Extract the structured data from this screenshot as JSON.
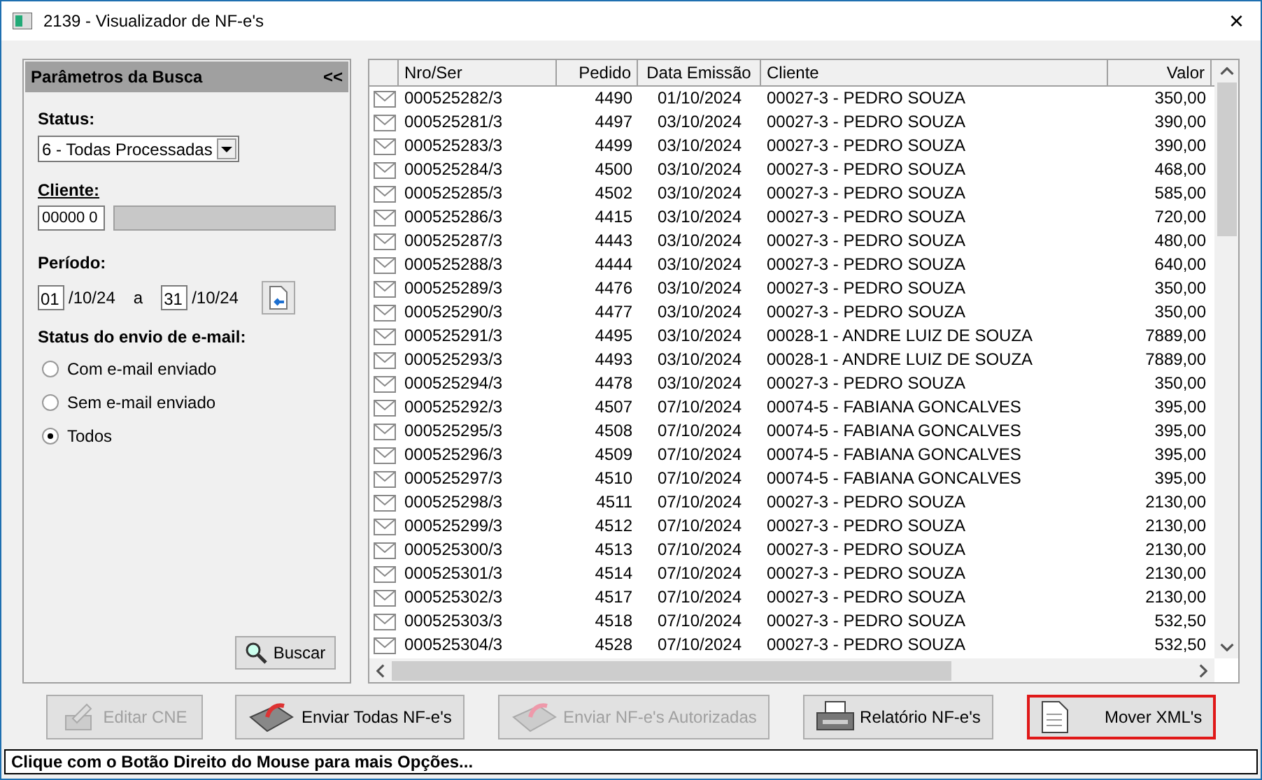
{
  "window": {
    "title": "2139 - Visualizador de NF-e's",
    "close": "×"
  },
  "search_panel": {
    "title": "Parâmetros da Busca",
    "collapse": "<<",
    "status_label": "Status:",
    "status_value": "6 - Todas Processadas",
    "client_label": "Cliente:",
    "client_code": "00000 0",
    "period_label": "Período:",
    "from_day": "01",
    "from_rest": "/10/24",
    "separator": "a",
    "to_day": "31",
    "to_rest": "/10/24",
    "email_label": "Status do envio de e-mail:",
    "email_options": [
      {
        "label": "Com e-mail enviado",
        "selected": false
      },
      {
        "label": "Sem e-mail enviado",
        "selected": false
      },
      {
        "label": "Todos",
        "selected": true
      }
    ],
    "search_button": "Buscar"
  },
  "table": {
    "columns": [
      "Nro/Ser",
      "Pedido",
      "Data Emissão",
      "Cliente",
      "Valor"
    ],
    "rows": [
      [
        "000525282/3",
        "4490",
        "01/10/2024",
        "00027-3 - PEDRO SOUZA",
        "350,00"
      ],
      [
        "000525281/3",
        "4497",
        "03/10/2024",
        "00027-3 - PEDRO SOUZA",
        "390,00"
      ],
      [
        "000525283/3",
        "4499",
        "03/10/2024",
        "00027-3 - PEDRO SOUZA",
        "390,00"
      ],
      [
        "000525284/3",
        "4500",
        "03/10/2024",
        "00027-3 - PEDRO SOUZA",
        "468,00"
      ],
      [
        "000525285/3",
        "4502",
        "03/10/2024",
        "00027-3 - PEDRO SOUZA",
        "585,00"
      ],
      [
        "000525286/3",
        "4415",
        "03/10/2024",
        "00027-3 - PEDRO SOUZA",
        "720,00"
      ],
      [
        "000525287/3",
        "4443",
        "03/10/2024",
        "00027-3 - PEDRO SOUZA",
        "480,00"
      ],
      [
        "000525288/3",
        "4444",
        "03/10/2024",
        "00027-3 - PEDRO SOUZA",
        "640,00"
      ],
      [
        "000525289/3",
        "4476",
        "03/10/2024",
        "00027-3 - PEDRO SOUZA",
        "350,00"
      ],
      [
        "000525290/3",
        "4477",
        "03/10/2024",
        "00027-3 - PEDRO SOUZA",
        "350,00"
      ],
      [
        "000525291/3",
        "4495",
        "03/10/2024",
        "00028-1 - ANDRE LUIZ DE SOUZA",
        "7889,00"
      ],
      [
        "000525293/3",
        "4493",
        "03/10/2024",
        "00028-1 - ANDRE LUIZ DE SOUZA",
        "7889,00"
      ],
      [
        "000525294/3",
        "4478",
        "03/10/2024",
        "00027-3 - PEDRO SOUZA",
        "350,00"
      ],
      [
        "000525292/3",
        "4507",
        "07/10/2024",
        "00074-5 - FABIANA GONCALVES",
        "395,00"
      ],
      [
        "000525295/3",
        "4508",
        "07/10/2024",
        "00074-5 - FABIANA GONCALVES",
        "395,00"
      ],
      [
        "000525296/3",
        "4509",
        "07/10/2024",
        "00074-5 - FABIANA GONCALVES",
        "395,00"
      ],
      [
        "000525297/3",
        "4510",
        "07/10/2024",
        "00074-5 - FABIANA GONCALVES",
        "395,00"
      ],
      [
        "000525298/3",
        "4511",
        "07/10/2024",
        "00027-3 - PEDRO SOUZA",
        "2130,00"
      ],
      [
        "000525299/3",
        "4512",
        "07/10/2024",
        "00027-3 - PEDRO SOUZA",
        "2130,00"
      ],
      [
        "000525300/3",
        "4513",
        "07/10/2024",
        "00027-3 - PEDRO SOUZA",
        "2130,00"
      ],
      [
        "000525301/3",
        "4514",
        "07/10/2024",
        "00027-3 - PEDRO SOUZA",
        "2130,00"
      ],
      [
        "000525302/3",
        "4517",
        "07/10/2024",
        "00027-3 - PEDRO SOUZA",
        "2130,00"
      ],
      [
        "000525303/3",
        "4518",
        "07/10/2024",
        "00027-3 - PEDRO SOUZA",
        "532,50"
      ],
      [
        "000525304/3",
        "4528",
        "07/10/2024",
        "00027-3 - PEDRO SOUZA",
        "532,50"
      ]
    ]
  },
  "buttons": [
    {
      "label": "Editar CNE",
      "kind": "edit",
      "disabled": true,
      "highlighted": false
    },
    {
      "label": "Enviar Todas NF-e's",
      "kind": "send",
      "disabled": false,
      "highlighted": false
    },
    {
      "label": "Enviar NF-e's Autorizadas",
      "kind": "send",
      "disabled": true,
      "highlighted": false
    },
    {
      "label": "Relatório NF-e's",
      "kind": "print",
      "disabled": false,
      "highlighted": false
    },
    {
      "label": "Mover XML's",
      "kind": "document",
      "disabled": false,
      "highlighted": true
    }
  ],
  "status_bar": "Clique com o Botão Direito do Mouse para mais Opções..."
}
